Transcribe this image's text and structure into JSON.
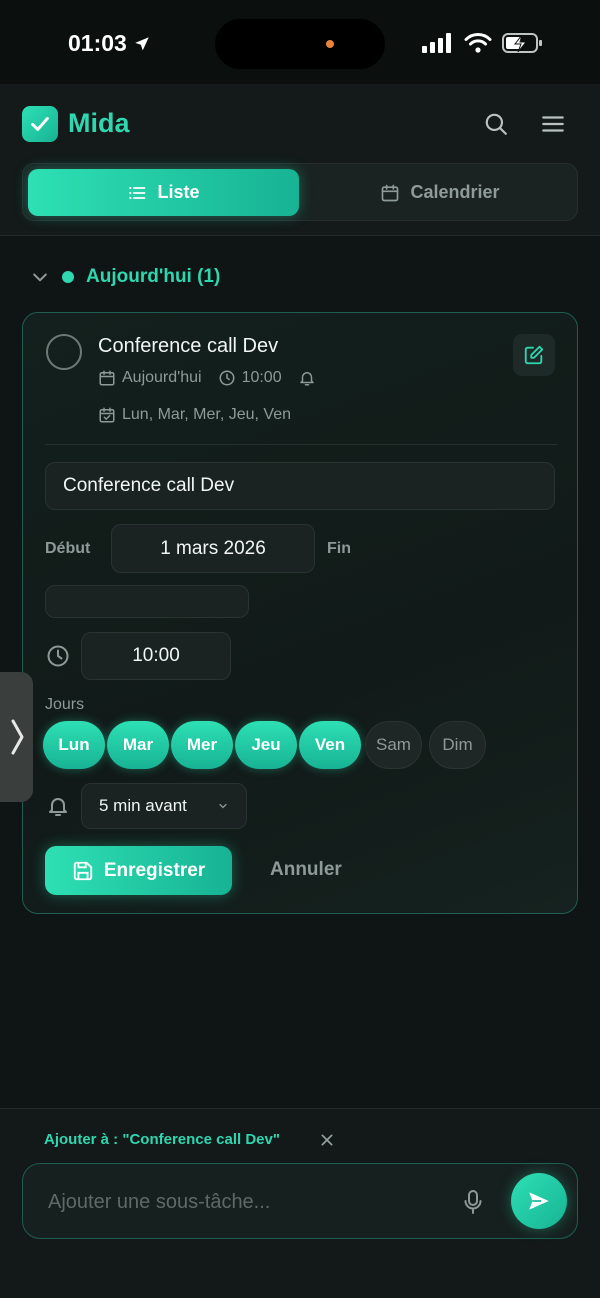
{
  "status_bar": {
    "time": "01:03"
  },
  "header": {
    "app_name": "Mida"
  },
  "view_tabs": [
    {
      "label": "Liste",
      "active": true
    },
    {
      "label": "Calendrier",
      "active": false
    }
  ],
  "section": {
    "title": "Aujourd'hui (1)"
  },
  "task": {
    "title": "Conference call Dev",
    "date_label": "Aujourd'hui",
    "time_label": "10:00",
    "repeat_days": "Lun, Mar, Mer, Jeu, Ven"
  },
  "editor": {
    "title_value": "Conference call Dev",
    "start_label": "Début",
    "start_value": "1 mars 2026",
    "end_label": "Fin",
    "end_value": "",
    "time_value": "10:00",
    "days_label": "Jours",
    "days": [
      {
        "label": "Lun",
        "selected": true
      },
      {
        "label": "Mar",
        "selected": true
      },
      {
        "label": "Mer",
        "selected": true
      },
      {
        "label": "Jeu",
        "selected": true
      },
      {
        "label": "Ven",
        "selected": true
      },
      {
        "label": "Sam",
        "selected": false
      },
      {
        "label": "Dim",
        "selected": false
      }
    ],
    "reminder_value": "5 min avant",
    "save_label": "Enregistrer",
    "cancel_label": "Annuler"
  },
  "bottom": {
    "add_to_label": "Ajouter à : \"Conference call Dev\"",
    "subtask_placeholder": "Ajouter une sous-tâche..."
  },
  "colors": {
    "accent": "#2fd6b0",
    "background": "#0f1514"
  }
}
